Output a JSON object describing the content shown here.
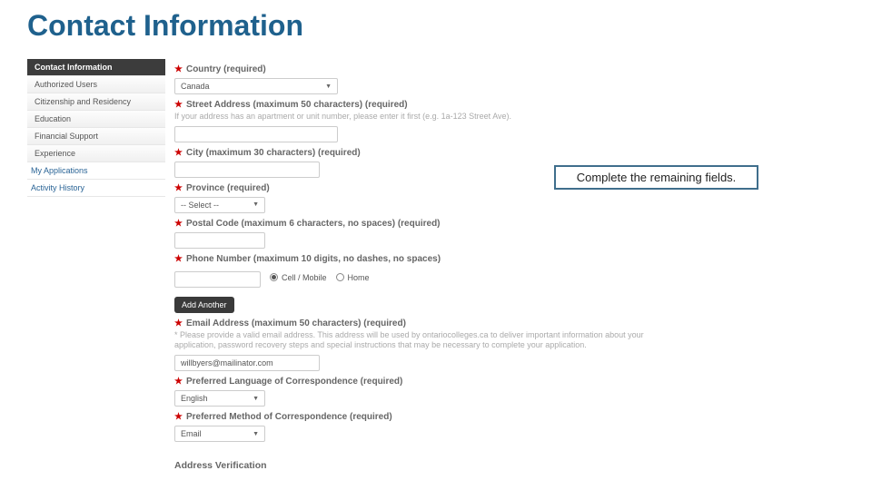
{
  "title": "Contact Information",
  "callout": "Complete the remaining fields.",
  "sidebar": {
    "items": [
      {
        "label": "Contact Information",
        "active": true
      },
      {
        "label": "Authorized Users"
      },
      {
        "label": "Citizenship and Residency"
      },
      {
        "label": "Education"
      },
      {
        "label": "Financial Support"
      },
      {
        "label": "Experience"
      }
    ],
    "topLevel": [
      {
        "label": "My Applications"
      },
      {
        "label": "Activity History"
      }
    ]
  },
  "form": {
    "country": {
      "label": "Country (required)",
      "value": "Canada"
    },
    "street": {
      "label": "Street Address (maximum 50 characters) (required)",
      "helper": "If your address has an apartment or unit number, please enter it first (e.g. 1a-123 Street Ave)."
    },
    "city": {
      "label": "City (maximum 30 characters) (required)"
    },
    "province": {
      "label": "Province (required)",
      "value": "-- Select --"
    },
    "postal": {
      "label": "Postal Code (maximum 6 characters, no spaces) (required)"
    },
    "phone": {
      "label": "Phone Number (maximum 10 digits, no dashes, no spaces)",
      "options": {
        "cell": "Cell / Mobile",
        "home": "Home"
      }
    },
    "addAnother": "Add Another",
    "email": {
      "label": "Email Address (maximum 50 characters) (required)",
      "helper": "* Please provide a valid email address. This address will be used by ontariocolleges.ca to deliver important information about your application, password recovery steps and special instructions that may be necessary to complete your application.",
      "value": "willbyers@mailinator.com"
    },
    "language": {
      "label": "Preferred Language of Correspondence (required)",
      "value": "English"
    },
    "method": {
      "label": "Preferred Method of Correspondence (required)",
      "value": "Email"
    },
    "addressVerification": "Address Verification"
  }
}
